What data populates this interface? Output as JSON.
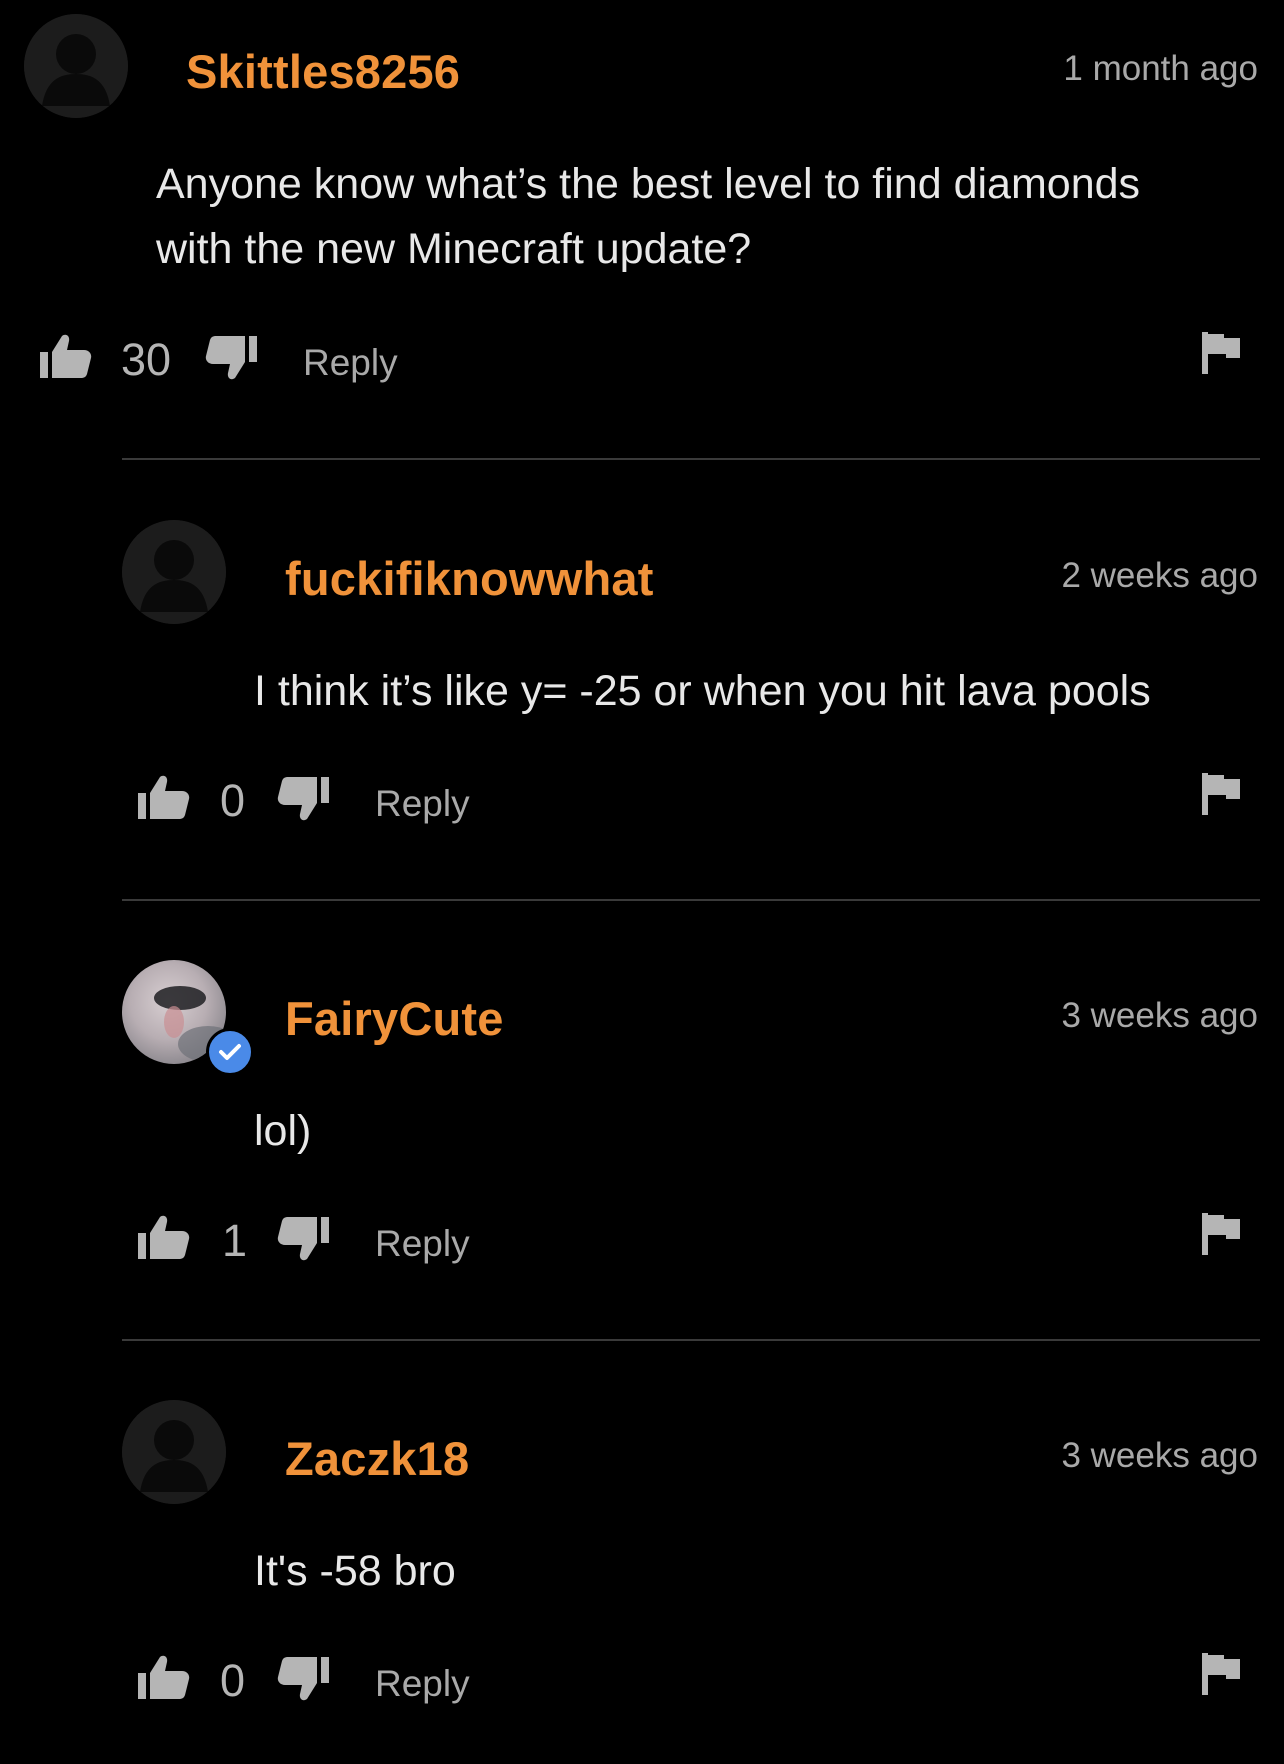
{
  "theme": {
    "background": "#000000",
    "username_color": "#f0923a",
    "text_color": "#e8e8e8",
    "muted_color": "#a9a9a9",
    "icon_color": "#b5b5b5",
    "verified_color": "#4a8ae8",
    "divider_color": "#3a3a3a"
  },
  "comments": [
    {
      "username": "Skittles8256",
      "timestamp": "1 month ago",
      "body_lines": [
        "Anyone know what’s the best level to find diamonds",
        "with the new Minecraft update?"
      ],
      "vote_count": "30",
      "reply_label": "Reply",
      "avatar": "default-silhouette",
      "verified": false
    },
    {
      "username": "fuckifiknowwhat",
      "timestamp": "2 weeks ago",
      "body_lines": [
        "I think it’s like y= -25 or when you hit lava pools"
      ],
      "vote_count": "0",
      "reply_label": "Reply",
      "avatar": "default-silhouette",
      "verified": false
    },
    {
      "username": "FairyCute",
      "timestamp": "3 weeks ago",
      "body_lines": [
        "lol)"
      ],
      "vote_count": "1",
      "reply_label": "Reply",
      "avatar": "photo",
      "verified": true
    },
    {
      "username": "Zaczk18",
      "timestamp": "3 weeks ago",
      "body_lines": [
        "It's -58 bro"
      ],
      "vote_count": "0",
      "reply_label": "Reply",
      "avatar": "default-silhouette",
      "verified": false
    }
  ],
  "icons": {
    "upvote": "thumbs-up-icon",
    "downvote": "thumbs-down-icon",
    "report": "flag-icon",
    "verified": "checkmark-icon",
    "avatar": "user-silhouette-icon"
  }
}
